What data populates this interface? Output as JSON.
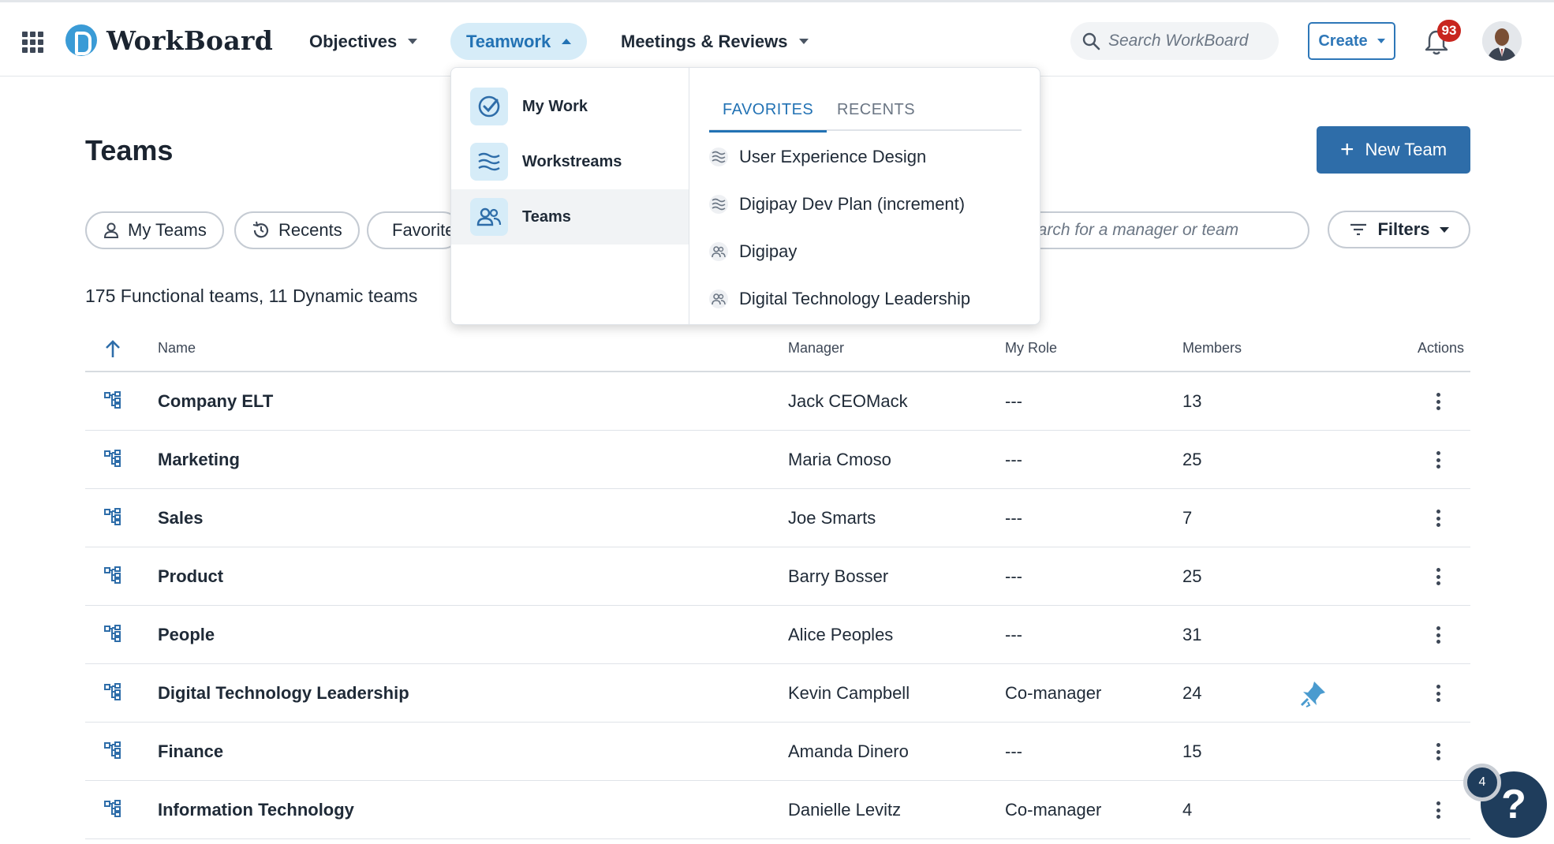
{
  "app": {
    "logo_text": "WorkBoard",
    "brand_color": "#3a9bd6",
    "accent_color": "#2e6da9"
  },
  "nav": {
    "objectives": "Objectives",
    "teamwork": "Teamwork",
    "meetings": "Meetings & Reviews"
  },
  "header": {
    "search_placeholder": "Search WorkBoard",
    "create_label": "Create",
    "notifications_count": "93"
  },
  "page": {
    "title": "Teams",
    "new_team_label": "New Team",
    "chips": {
      "my_teams": "My Teams",
      "recents": "Recents",
      "favorites": "Favorites"
    },
    "team_search_placeholder": "Search for a manager or team",
    "filters_label": "Filters",
    "count_text": "175 Functional teams, 11 Dynamic teams"
  },
  "table": {
    "columns": {
      "name": "Name",
      "manager": "Manager",
      "role": "My Role",
      "members": "Members",
      "actions": "Actions"
    },
    "rows": [
      {
        "name": "Company ELT",
        "manager": "Jack CEOMack",
        "role": "---",
        "members": "13",
        "pinned": false
      },
      {
        "name": "Marketing",
        "manager": "Maria Cmoso",
        "role": "---",
        "members": "25",
        "pinned": false
      },
      {
        "name": "Sales",
        "manager": "Joe Smarts",
        "role": "---",
        "members": "7",
        "pinned": false
      },
      {
        "name": "Product",
        "manager": "Barry Bosser",
        "role": "---",
        "members": "25",
        "pinned": false
      },
      {
        "name": "People",
        "manager": "Alice Peoples",
        "role": "---",
        "members": "31",
        "pinned": false
      },
      {
        "name": "Digital Technology Leadership",
        "manager": "Kevin Campbell",
        "role": "Co-manager",
        "members": "24",
        "pinned": true
      },
      {
        "name": "Finance",
        "manager": "Amanda Dinero",
        "role": "---",
        "members": "15",
        "pinned": false
      },
      {
        "name": "Information Technology",
        "manager": "Danielle Levitz",
        "role": "Co-manager",
        "members": "4",
        "pinned": false
      }
    ]
  },
  "teamwork_menu": {
    "items": [
      {
        "label": "My Work",
        "icon": "check-circle-icon"
      },
      {
        "label": "Workstreams",
        "icon": "workstream-icon"
      },
      {
        "label": "Teams",
        "icon": "people-icon"
      }
    ],
    "tabs": {
      "favorites": "FAVORITES",
      "recents": "RECENTS"
    },
    "favorites": [
      {
        "label": "User Experience Design",
        "icon": "workstream-icon"
      },
      {
        "label": "Digipay Dev Plan (increment)",
        "icon": "workstream-icon"
      },
      {
        "label": "Digipay",
        "icon": "people-icon"
      },
      {
        "label": "Digital Technology Leadership",
        "icon": "people-icon"
      }
    ]
  },
  "help": {
    "label": "?",
    "count": "4"
  }
}
